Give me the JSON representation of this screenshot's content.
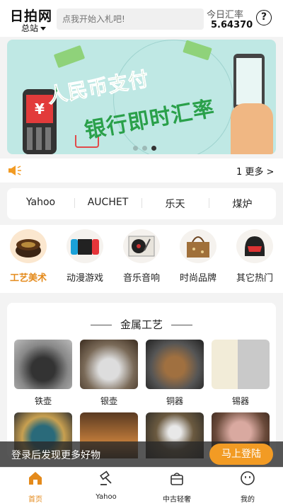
{
  "header": {
    "logo": "日拍网",
    "station": "总站",
    "search_placeholder": "点我开始入札吧!",
    "rate_label": "今日汇率",
    "rate_value": "5.64370",
    "help": "?"
  },
  "banner": {
    "line1": "人民币支付",
    "line2": "银行即时汇率",
    "currency_symbol": "¥",
    "page_count": 3,
    "active_index": 2
  },
  "notice": {
    "more": "1 更多 >"
  },
  "sites": [
    "Yahoo",
    "AUCHET",
    "乐天",
    "煤炉"
  ],
  "categories": [
    {
      "label": "工艺美术",
      "active": true
    },
    {
      "label": "动漫游戏",
      "active": false
    },
    {
      "label": "音乐音响",
      "active": false
    },
    {
      "label": "时尚品牌",
      "active": false
    },
    {
      "label": "其它热门",
      "active": false
    }
  ],
  "section": {
    "title": "金属工艺",
    "products": [
      {
        "label": "铁壶"
      },
      {
        "label": "银壶"
      },
      {
        "label": "铜器"
      },
      {
        "label": "锡器"
      }
    ]
  },
  "login_bar": {
    "text": "登录后发现更多好物",
    "button": "马上登陆"
  },
  "tabbar": [
    {
      "label": "首页",
      "active": true
    },
    {
      "label": "Yahoo",
      "active": false
    },
    {
      "label": "中古轻奢",
      "active": false
    },
    {
      "label": "我的",
      "active": false
    }
  ],
  "colors": {
    "accent": "#e48a1b",
    "login_button": "#f29b24",
    "banner_bg": "#bfe8e4",
    "banner_text": "#2aa04a"
  }
}
